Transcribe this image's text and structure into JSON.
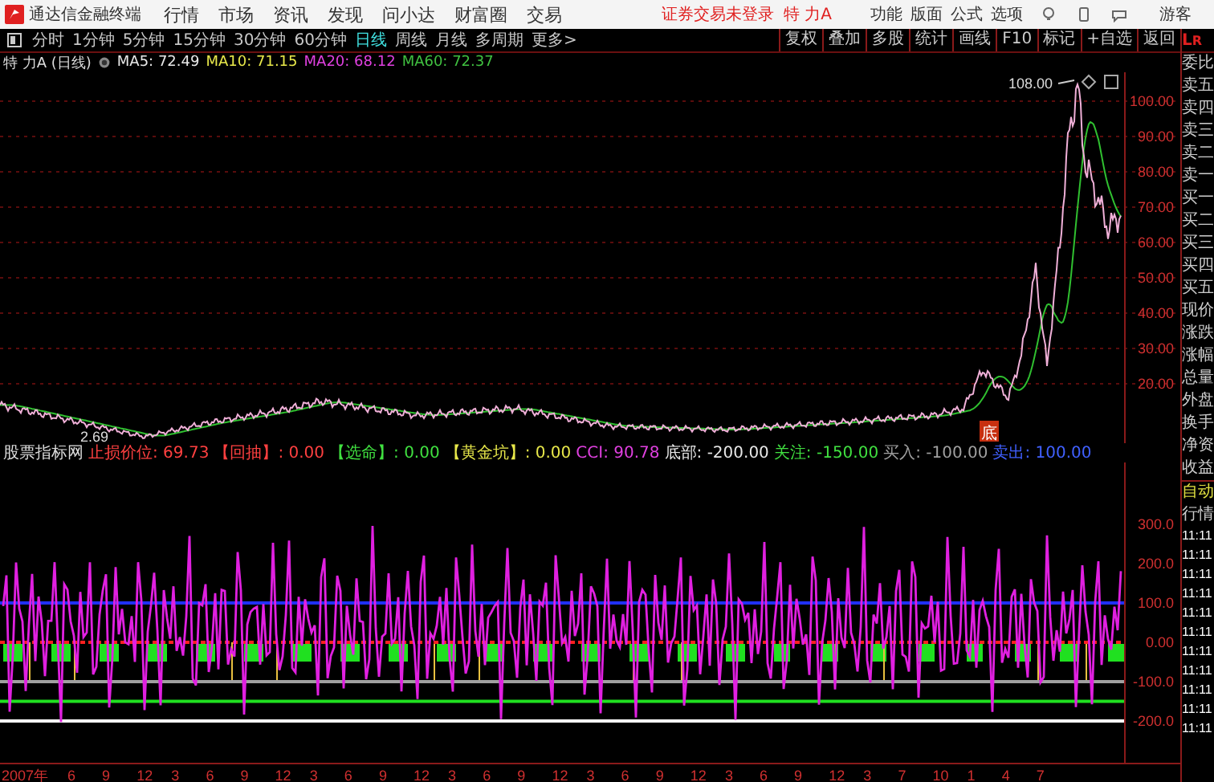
{
  "menu_bar": {
    "app_title": "通达信金融终端",
    "menus": [
      "行情",
      "市场",
      "资讯",
      "发现",
      "问小达",
      "财富圈",
      "交易"
    ],
    "login_status": "证券交易未登录",
    "stock": "特 力A",
    "actions": [
      "功能",
      "版面",
      "公式",
      "选项"
    ],
    "user": "游客"
  },
  "period_tabs": [
    {
      "label": "分时",
      "selected": false
    },
    {
      "label": "1分钟",
      "selected": false
    },
    {
      "label": "5分钟",
      "selected": false
    },
    {
      "label": "15分钟",
      "selected": false
    },
    {
      "label": "30分钟",
      "selected": false
    },
    {
      "label": "60分钟",
      "selected": false
    },
    {
      "label": "日线",
      "selected": true
    },
    {
      "label": "周线",
      "selected": false
    },
    {
      "label": "月线",
      "selected": false
    },
    {
      "label": "多周期",
      "selected": false
    },
    {
      "label": "更多>",
      "selected": false
    }
  ],
  "tools": [
    "复权",
    "叠加",
    "多股",
    "统计",
    "画线",
    "F10",
    "标记",
    "+自选",
    "返回"
  ],
  "side_tabs": [
    "L",
    "R"
  ],
  "ma_line": {
    "title": "特 力A (日线)",
    "items": [
      {
        "label": "MA5: 72.49",
        "color": "#e8e8e8"
      },
      {
        "label": "MA10: 71.15",
        "color": "#e8e84a"
      },
      {
        "label": "MA20: 68.12",
        "color": "#e040e0"
      },
      {
        "label": "MA60: 72.37",
        "color": "#40c040"
      }
    ]
  },
  "price_chart": {
    "high_label": "108.00",
    "low_label": "2.69",
    "signal_mark": "底",
    "axis": [
      "100.00",
      "90.00",
      "80.00",
      "70.00",
      "60.00",
      "50.00",
      "40.00",
      "30.00",
      "20.00"
    ]
  },
  "indicator": {
    "name": "股票指标网",
    "values": [
      {
        "label": "止损价位: 69.73",
        "color": "#ff4040"
      },
      {
        "label": "【回抽】: 0.00",
        "color": "#ff4040"
      },
      {
        "label": "【选命】: 0.00",
        "color": "#40e040"
      },
      {
        "label": "【黄金坑】: 0.00",
        "color": "#e8e84a"
      },
      {
        "label": "CCI: 90.78",
        "color": "#e040e0"
      },
      {
        "label": "底部: -200.00",
        "color": "#e8e8e8"
      },
      {
        "label": "关注: -150.00",
        "color": "#40e040"
      },
      {
        "label": "买入: -100.00",
        "color": "#a0a0a0"
      },
      {
        "label": "卖出: 100.00",
        "color": "#4060ff"
      }
    ],
    "axis": [
      "300.0",
      "200.0",
      "100.0",
      "0.00",
      "-100.0",
      "-200.0"
    ]
  },
  "quote_panel": {
    "labels": [
      "委比",
      "卖五",
      "卖四",
      "卖三",
      "卖二",
      "卖一",
      "买一",
      "买二",
      "买三",
      "买四",
      "买五",
      "现价",
      "涨跌",
      "涨幅",
      "总量",
      "外盘",
      "换手",
      "净资",
      "收益"
    ],
    "mode_labels": [
      "自动",
      "行情"
    ],
    "times": [
      "11:11",
      "11:11",
      "11:11",
      "11:11",
      "11:11",
      "11:11",
      "11:11",
      "11:11",
      "11:11",
      "11:11",
      "11:11"
    ]
  },
  "date_axis": [
    "2007年",
    "6",
    "9",
    "12",
    "3",
    "6",
    "9",
    "12",
    "3",
    "6",
    "9",
    "12",
    "3",
    "6",
    "9",
    "12",
    "3",
    "6",
    "9",
    "12",
    "3",
    "6",
    "9",
    "12",
    "3",
    "7",
    "10",
    "1",
    "4",
    "7"
  ]
}
